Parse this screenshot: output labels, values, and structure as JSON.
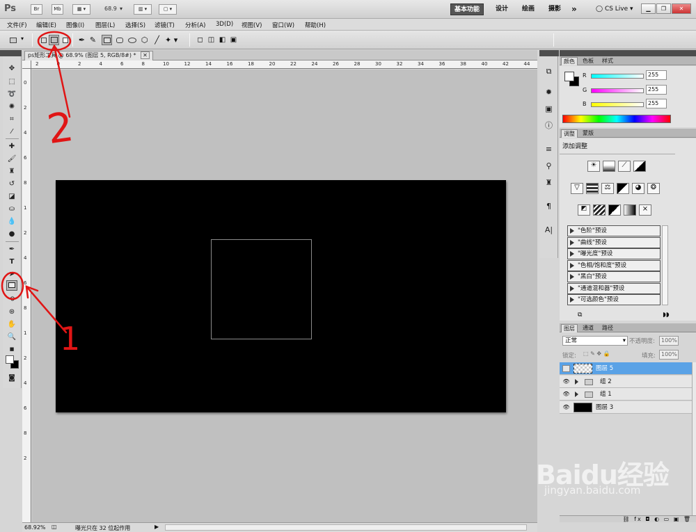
{
  "app": {
    "logo": "Ps",
    "bridge": "Br",
    "minibridge": "Mb",
    "zoom": "68.9",
    "workspaces": [
      "基本功能",
      "设计",
      "绘画",
      "摄影"
    ],
    "more": "»",
    "cslive": "CS Live"
  },
  "menu": [
    "文件(F)",
    "编辑(E)",
    "图像(I)",
    "图层(L)",
    "选择(S)",
    "滤镜(T)",
    "分析(A)",
    "3D(D)",
    "视图(V)",
    "窗口(W)",
    "帮助(H)"
  ],
  "document": {
    "tab_title": "ps矩形工具 @ 68.9% (图层 5, RGB/8#) *",
    "ruler_h": [
      "2",
      "0",
      "2",
      "4",
      "6",
      "8",
      "10",
      "12",
      "14",
      "16",
      "18",
      "20",
      "22",
      "24",
      "26",
      "28",
      "30",
      "32",
      "34",
      "36",
      "38",
      "40",
      "42",
      "44"
    ],
    "ruler_v": [
      "0",
      "2",
      "4",
      "6",
      "8",
      "1",
      "2",
      "4",
      "6",
      "8",
      "1",
      "2",
      "4",
      "6",
      "8",
      "2"
    ]
  },
  "status": {
    "zoom": "68.92%",
    "message": "曝光只在 32 位起作用"
  },
  "color_panel": {
    "tabs": [
      "颜色",
      "色板",
      "样式"
    ],
    "channels": [
      {
        "label": "R",
        "value": "255"
      },
      {
        "label": "G",
        "value": "255"
      },
      {
        "label": "B",
        "value": "255"
      }
    ]
  },
  "adjust_panel": {
    "tabs": [
      "调整",
      "蒙版"
    ],
    "title": "添加调整",
    "presets": [
      "\"色阶\"预设",
      "\"曲线\"预设",
      "\"曝光度\"预设",
      "\"色相/饱和度\"预设",
      "\"黑白\"预设",
      "\"通道混和器\"预设",
      "\"可选颜色\"预设"
    ]
  },
  "layers_panel": {
    "tabs": [
      "图层",
      "通道",
      "路径"
    ],
    "blend_mode": "正常",
    "opacity_label": "不透明度:",
    "opacity": "100%",
    "lock_label": "锁定:",
    "fill_label": "填充:",
    "fill": "100%",
    "layers": [
      {
        "name": "图层 5",
        "kind": "layer",
        "selected": true,
        "visible": false
      },
      {
        "name": "组 2",
        "kind": "group",
        "selected": false,
        "visible": true
      },
      {
        "name": "组 1",
        "kind": "group",
        "selected": false,
        "visible": true
      },
      {
        "name": "图层 3",
        "kind": "layer",
        "selected": false,
        "visible": true
      }
    ]
  },
  "annotations": {
    "label_1": "1",
    "label_2": "2",
    "color": "#e01515"
  },
  "watermark": {
    "logo": "Baidu经验",
    "url": "jingyan.baidu.com"
  }
}
